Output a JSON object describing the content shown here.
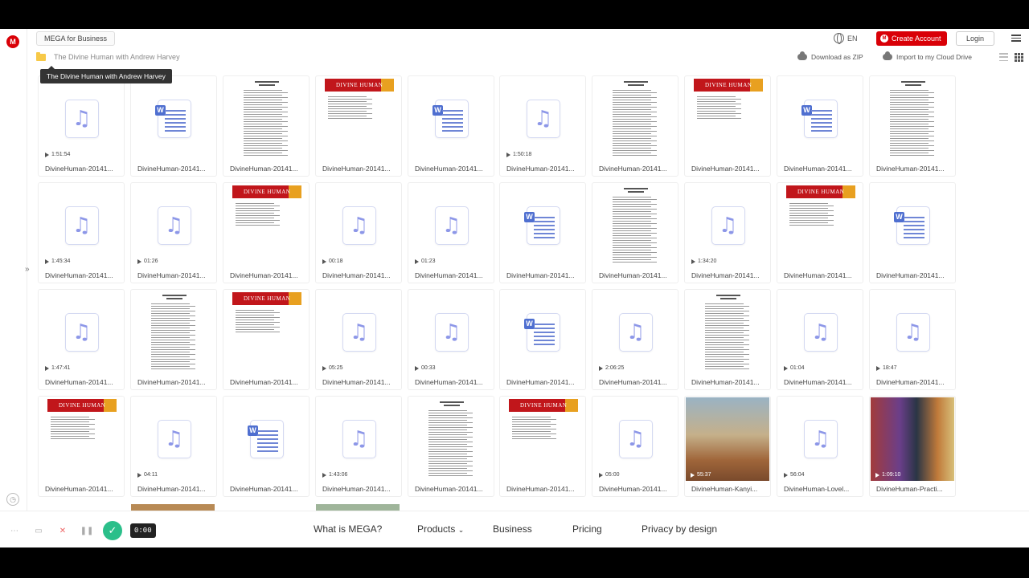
{
  "top_bar": {
    "business_label": "MEGA for Business",
    "language": "EN",
    "create_account": "Create Account",
    "login": "Login"
  },
  "toolbar": {
    "breadcrumb": "The Divine Human with Andrew Harvey",
    "download_zip": "Download as ZIP",
    "import_cloud": "Import to my Cloud Drive"
  },
  "tooltip": "The Divine Human with Andrew Harvey",
  "files": [
    {
      "name": "DivineHuman-20141...",
      "kind": "audio",
      "duration": "1:51:54"
    },
    {
      "name": "DivineHuman-20141...",
      "kind": "word"
    },
    {
      "name": "DivineHuman-20141...",
      "kind": "doc"
    },
    {
      "name": "DivineHuman-20141...",
      "kind": "banner"
    },
    {
      "name": "DivineHuman-20141...",
      "kind": "word"
    },
    {
      "name": "DivineHuman-20141...",
      "kind": "audio",
      "duration": "1:50:18"
    },
    {
      "name": "DivineHuman-20141...",
      "kind": "doc"
    },
    {
      "name": "DivineHuman-20141...",
      "kind": "banner"
    },
    {
      "name": "DivineHuman-20141...",
      "kind": "word"
    },
    {
      "name": "DivineHuman-20141...",
      "kind": "doc"
    },
    {
      "name": "DivineHuman-20141...",
      "kind": "audio",
      "duration": "1:45:34"
    },
    {
      "name": "DivineHuman-20141...",
      "kind": "audio",
      "duration": "01:26"
    },
    {
      "name": "DivineHuman-20141...",
      "kind": "banner"
    },
    {
      "name": "DivineHuman-20141...",
      "kind": "audio",
      "duration": "00:18"
    },
    {
      "name": "DivineHuman-20141...",
      "kind": "audio",
      "duration": "01:23"
    },
    {
      "name": "DivineHuman-20141...",
      "kind": "word"
    },
    {
      "name": "DivineHuman-20141...",
      "kind": "doc"
    },
    {
      "name": "DivineHuman-20141...",
      "kind": "audio",
      "duration": "1:34:20"
    },
    {
      "name": "DivineHuman-20141...",
      "kind": "banner"
    },
    {
      "name": "DivineHuman-20141...",
      "kind": "word"
    },
    {
      "name": "DivineHuman-20141...",
      "kind": "audio",
      "duration": "1:47:41"
    },
    {
      "name": "DivineHuman-20141...",
      "kind": "doc"
    },
    {
      "name": "DivineHuman-20141...",
      "kind": "banner"
    },
    {
      "name": "DivineHuman-20141...",
      "kind": "audio",
      "duration": "05:25"
    },
    {
      "name": "DivineHuman-20141...",
      "kind": "audio",
      "duration": "00:33"
    },
    {
      "name": "DivineHuman-20141...",
      "kind": "word"
    },
    {
      "name": "DivineHuman-20141...",
      "kind": "audio",
      "duration": "2:06:25"
    },
    {
      "name": "DivineHuman-20141...",
      "kind": "doc"
    },
    {
      "name": "DivineHuman-20141...",
      "kind": "audio",
      "duration": "01:04"
    },
    {
      "name": "DivineHuman-20141...",
      "kind": "audio",
      "duration": "18:47"
    },
    {
      "name": "DivineHuman-20141...",
      "kind": "banner"
    },
    {
      "name": "DivineHuman-20141...",
      "kind": "audio",
      "duration": "04:11"
    },
    {
      "name": "DivineHuman-20141...",
      "kind": "word"
    },
    {
      "name": "DivineHuman-20141...",
      "kind": "audio",
      "duration": "1:43:06"
    },
    {
      "name": "DivineHuman-20141...",
      "kind": "doc"
    },
    {
      "name": "DivineHuman-20141...",
      "kind": "banner"
    },
    {
      "name": "DivineHuman-20141...",
      "kind": "audio",
      "duration": "05:00"
    },
    {
      "name": "DivineHuman-Kanyi...",
      "kind": "video1",
      "duration": "55:37"
    },
    {
      "name": "DivineHuman-Lovel...",
      "kind": "audio",
      "duration": "56:04"
    },
    {
      "name": "DivineHuman-Practi...",
      "kind": "video2",
      "duration": "1:09:10"
    }
  ],
  "banner_text": "DIVINE HUMAN",
  "footer": {
    "what_is": "What is MEGA?",
    "products": "Products",
    "business": "Business",
    "pricing": "Pricing",
    "privacy": "Privacy by design"
  },
  "recorder": {
    "time": "0:00"
  }
}
